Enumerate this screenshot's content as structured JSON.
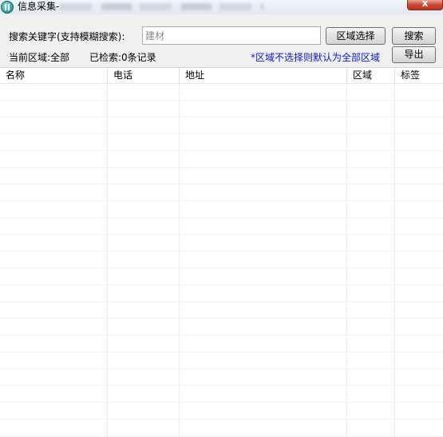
{
  "window": {
    "title": "信息采集-",
    "close_symbol": "x"
  },
  "toolbar": {
    "search_label": "搜索关键字(支持模糊搜索):",
    "search_placeholder": "建材",
    "region_button": "区域选择",
    "search_button": "搜索",
    "export_button": "导出",
    "current_region": "当前区域:全部",
    "result_count": "已检索:0条记录",
    "hint": "*区域不选择则默认为全部区域"
  },
  "table": {
    "columns": [
      "名称",
      "电话",
      "地址",
      "区域",
      "标签"
    ],
    "rows": []
  },
  "colors": {
    "hint_text": "#0b19c9",
    "close_button": "#c74530"
  }
}
